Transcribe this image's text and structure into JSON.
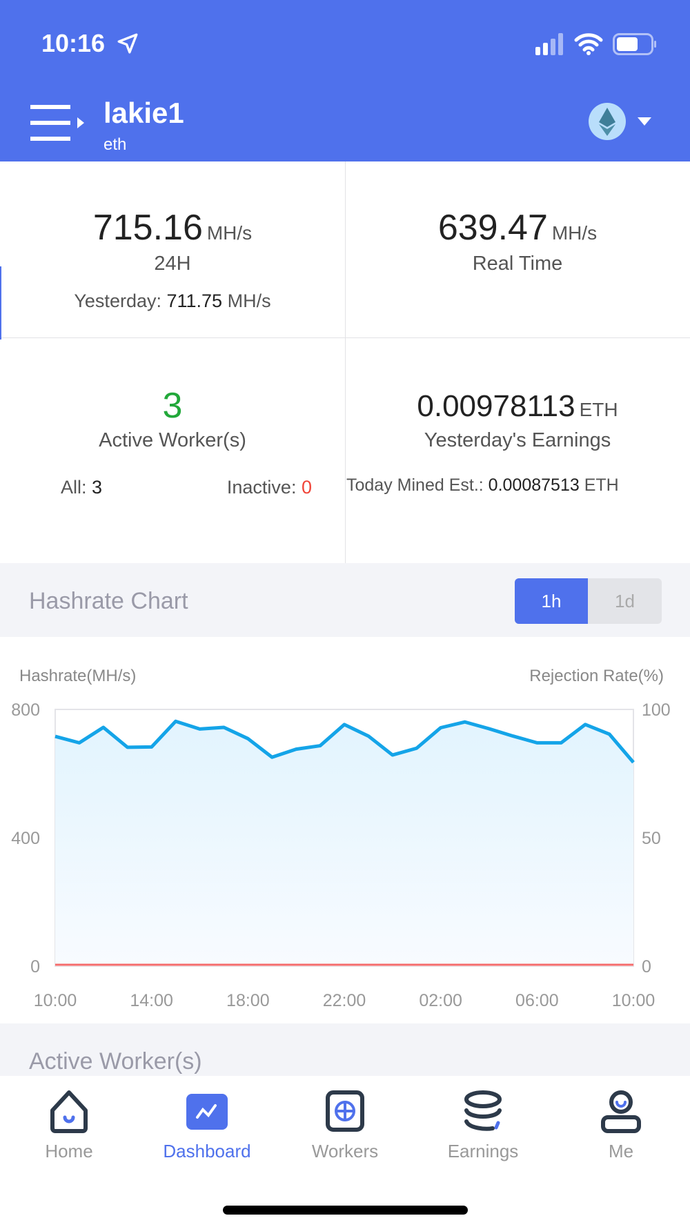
{
  "status_bar": {
    "time": "10:16",
    "icons": [
      "location-arrow-icon",
      "signal-icon",
      "wifi-icon",
      "battery-icon"
    ]
  },
  "header": {
    "title": "lakie1",
    "subtitle": "eth",
    "coin_icon": "ethereum-icon",
    "menu_icon": "menu-icon"
  },
  "stats": {
    "hashrate_24h": {
      "value": "715.16",
      "unit": "MH/s",
      "label": "24H",
      "yesterday_label": "Yesterday:",
      "yesterday_value": "711.75",
      "yesterday_unit": "MH/s"
    },
    "realtime": {
      "value": "639.47",
      "unit": "MH/s",
      "label": "Real Time"
    },
    "workers": {
      "value": "3",
      "label": "Active Worker(s)",
      "all_label": "All:",
      "all_value": "3",
      "inactive_label": "Inactive:",
      "inactive_value": "0"
    },
    "earnings": {
      "value": "0.00978113",
      "unit": "ETH",
      "label": "Yesterday's Earnings",
      "today_label": "Today Mined Est.:",
      "today_value": "0.00087513",
      "today_unit": "ETH"
    }
  },
  "hashrate_section": {
    "title": "Hashrate Chart",
    "toggle": [
      {
        "label": "1h",
        "active": true
      },
      {
        "label": "1d",
        "active": false
      }
    ]
  },
  "chart_data": {
    "type": "area",
    "ylabel": "Hashrate(MH/s)",
    "y2label": "Rejection Rate(%)",
    "ylim": [
      0,
      800
    ],
    "y2lim": [
      0,
      100
    ],
    "yticks": [
      "800",
      "400",
      "0"
    ],
    "y2ticks": [
      "100",
      "50",
      "0"
    ],
    "xticks": [
      "10:00",
      "14:00",
      "18:00",
      "22:00",
      "02:00",
      "06:00",
      "10:00"
    ],
    "x": [
      "10:00",
      "11:00",
      "12:00",
      "13:00",
      "14:00",
      "15:00",
      "16:00",
      "17:00",
      "18:00",
      "19:00",
      "20:00",
      "21:00",
      "22:00",
      "23:00",
      "00:00",
      "01:00",
      "02:00",
      "03:00",
      "04:00",
      "05:00",
      "06:00",
      "07:00",
      "08:00",
      "09:00",
      "10:00"
    ],
    "grid": true,
    "series": [
      {
        "name": "Hashrate",
        "axis": "left",
        "color": "#14A4E8",
        "values": [
          716,
          696,
          744,
          682,
          683,
          763,
          739,
          744,
          709,
          651,
          676,
          687,
          753,
          717,
          658,
          679,
          743,
          761,
          740,
          717,
          696,
          696,
          753,
          723,
          635
        ]
      },
      {
        "name": "Rejection Rate",
        "axis": "right",
        "color": "#F56C6C",
        "values": [
          0,
          0,
          0,
          0,
          0,
          0,
          0,
          0,
          0,
          0,
          0,
          0,
          0,
          0,
          0,
          0,
          0,
          0,
          0,
          0,
          0,
          0,
          0,
          0,
          0
        ]
      }
    ]
  },
  "active_workers_section": {
    "title": "Active Worker(s)"
  },
  "nav": [
    {
      "label": "Home",
      "icon": "home-icon"
    },
    {
      "label": "Dashboard",
      "icon": "dashboard-icon",
      "active": true
    },
    {
      "label": "Workers",
      "icon": "workers-icon"
    },
    {
      "label": "Earnings",
      "icon": "earnings-icon"
    },
    {
      "label": "Me",
      "icon": "profile-icon"
    }
  ],
  "colors": {
    "primary": "#4F71EC",
    "active_green": "#22A83A",
    "inactive_red": "#F04438",
    "line": "#14A4E8"
  }
}
